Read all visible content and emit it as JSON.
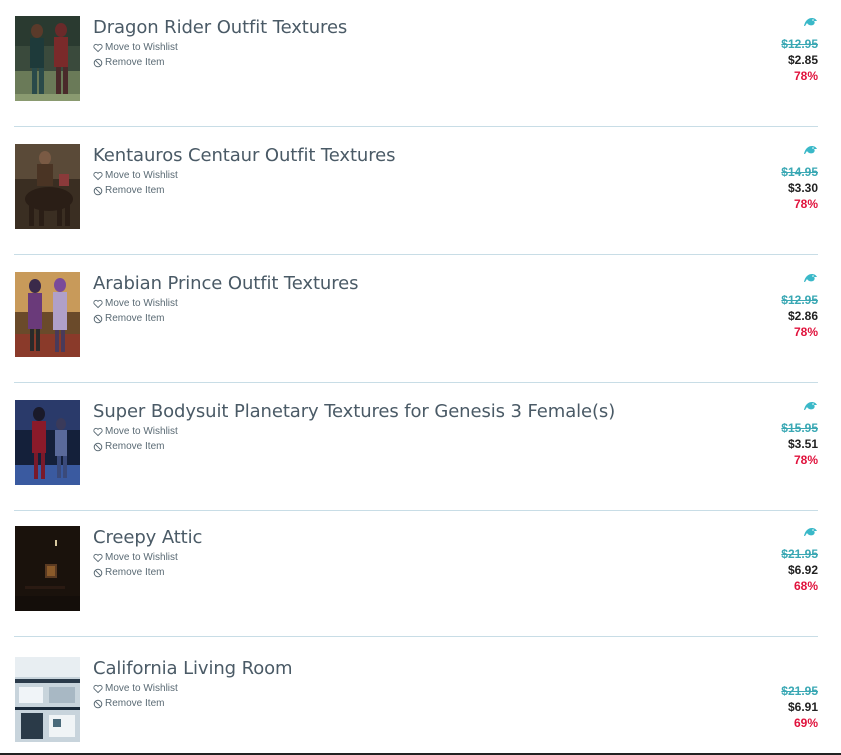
{
  "items": [
    {
      "title": "Dragon Rider Outfit Textures",
      "wishlist_label": "Move to Wishlist",
      "remove_label": "Remove Item",
      "original_price": "$12.95",
      "sale_price": "$2.85",
      "discount": "78%",
      "has_badge": true,
      "thumb_icon": "product-thumbnail"
    },
    {
      "title": "Kentauros Centaur Outfit Textures",
      "wishlist_label": "Move to Wishlist",
      "remove_label": "Remove Item",
      "original_price": "$14.95",
      "sale_price": "$3.30",
      "discount": "78%",
      "has_badge": true,
      "thumb_icon": "product-thumbnail"
    },
    {
      "title": "Arabian Prince Outfit Textures",
      "wishlist_label": "Move to Wishlist",
      "remove_label": "Remove Item",
      "original_price": "$12.95",
      "sale_price": "$2.86",
      "discount": "78%",
      "has_badge": true,
      "thumb_icon": "product-thumbnail"
    },
    {
      "title": "Super Bodysuit Planetary Textures for Genesis 3 Female(s)",
      "wishlist_label": "Move to Wishlist",
      "remove_label": "Remove Item",
      "original_price": "$15.95",
      "sale_price": "$3.51",
      "discount": "78%",
      "has_badge": true,
      "thumb_icon": "product-thumbnail"
    },
    {
      "title": "Creepy Attic",
      "wishlist_label": "Move to Wishlist",
      "remove_label": "Remove Item",
      "original_price": "$21.95",
      "sale_price": "$6.92",
      "discount": "68%",
      "has_badge": true,
      "thumb_icon": "product-thumbnail"
    },
    {
      "title": "California Living Room",
      "wishlist_label": "Move to Wishlist",
      "remove_label": "Remove Item",
      "original_price": "$21.95",
      "sale_price": "$6.91",
      "discount": "69%",
      "has_badge": false,
      "thumb_icon": "product-thumbnail"
    }
  ],
  "icons": {
    "wishlist": "heart-icon",
    "remove": "ban-icon",
    "badge": "daz-dragon-icon"
  },
  "colors": {
    "title": "#4a5a66",
    "original_price": "#3aa8b4",
    "discount": "#e0123c",
    "badge": "#3ab8c8",
    "divider": "#c8dde6"
  }
}
